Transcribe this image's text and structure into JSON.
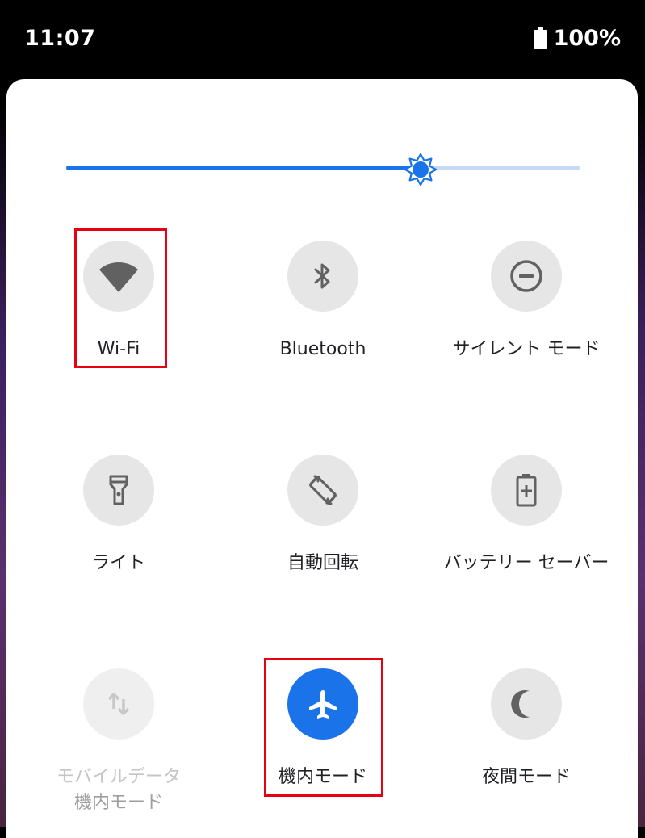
{
  "status_bar": {
    "time": "11:07",
    "battery": "100%"
  },
  "brightness": {
    "level": 0.69,
    "icon": "brightness-icon"
  },
  "tiles": [
    {
      "label": "Wi-Fi",
      "icon": "wifi-icon",
      "state": "off"
    },
    {
      "label": "Bluetooth",
      "icon": "bluetooth-icon",
      "state": "off"
    },
    {
      "label": "サイレント モード",
      "icon": "do-not-disturb-icon",
      "state": "off"
    },
    {
      "label": "ライト",
      "icon": "flashlight-icon",
      "state": "off"
    },
    {
      "label": "自動回転",
      "icon": "auto-rotate-icon",
      "state": "off"
    },
    {
      "label": "バッテリー セーバー",
      "icon": "battery-saver-icon",
      "state": "off"
    },
    {
      "label": "モバイルデータ",
      "sublabel": "機内モード",
      "icon": "mobile-data-icon",
      "state": "disabled"
    },
    {
      "label": "機内モード",
      "icon": "airplane-icon",
      "state": "on"
    },
    {
      "label": "夜間モード",
      "icon": "night-mode-icon",
      "state": "off"
    }
  ],
  "colors": {
    "accent": "#1a73e8",
    "tile_off": "#e6e6e6",
    "highlight": "#e60012"
  }
}
